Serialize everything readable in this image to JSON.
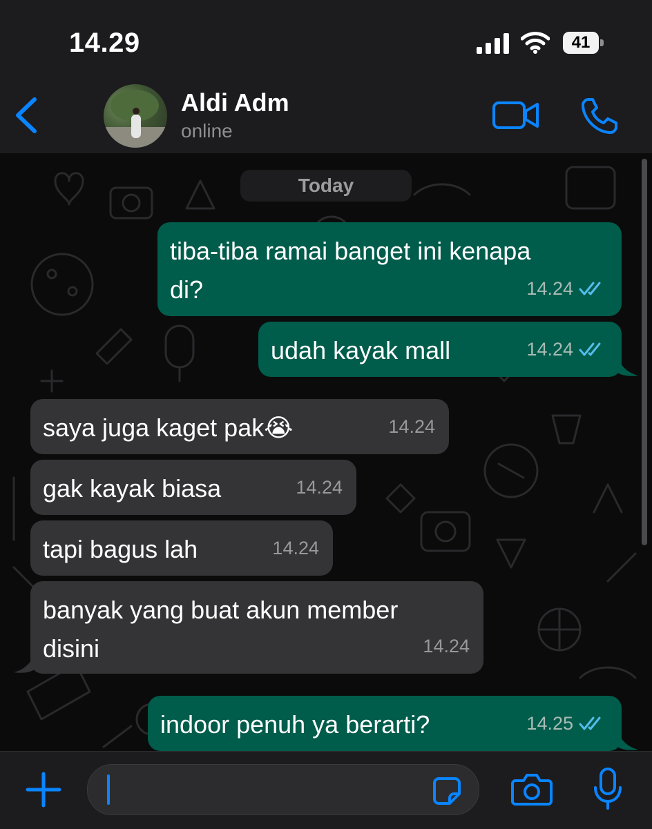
{
  "status_bar": {
    "time": "14.29",
    "battery": "41"
  },
  "header": {
    "contact_name": "Aldi Adm",
    "contact_status": "online",
    "icons": [
      "back-chevron-icon",
      "video-call-icon",
      "voice-call-icon"
    ]
  },
  "chat": {
    "date_separator": "Today",
    "messages": [
      {
        "direction": "outgoing",
        "text": "tiba-tiba ramai banget ini kenapa\ndi?",
        "time": "14.24",
        "status": "read"
      },
      {
        "direction": "outgoing",
        "text": "udah kayak mall",
        "time": "14.24",
        "status": "read"
      },
      {
        "direction": "incoming",
        "text": "saya juga kaget pak😭",
        "time": "14.24"
      },
      {
        "direction": "incoming",
        "text": "gak kayak biasa",
        "time": "14.24"
      },
      {
        "direction": "incoming",
        "text": "tapi bagus lah",
        "time": "14.24"
      },
      {
        "direction": "incoming",
        "text": "banyak yang buat akun member\ndisini",
        "time": "14.24"
      },
      {
        "direction": "outgoing",
        "text": "indoor penuh ya berarti?",
        "time": "14.25",
        "status": "read"
      }
    ]
  },
  "input_bar": {
    "message_value": "",
    "icons": [
      "plus-icon",
      "sticker-icon",
      "camera-icon",
      "microphone-icon"
    ]
  },
  "colors": {
    "accent": "#0a84ff",
    "outgoing_bubble": "#005c4b",
    "incoming_bubble": "#343436",
    "read_ticks": "#53bdeb"
  }
}
